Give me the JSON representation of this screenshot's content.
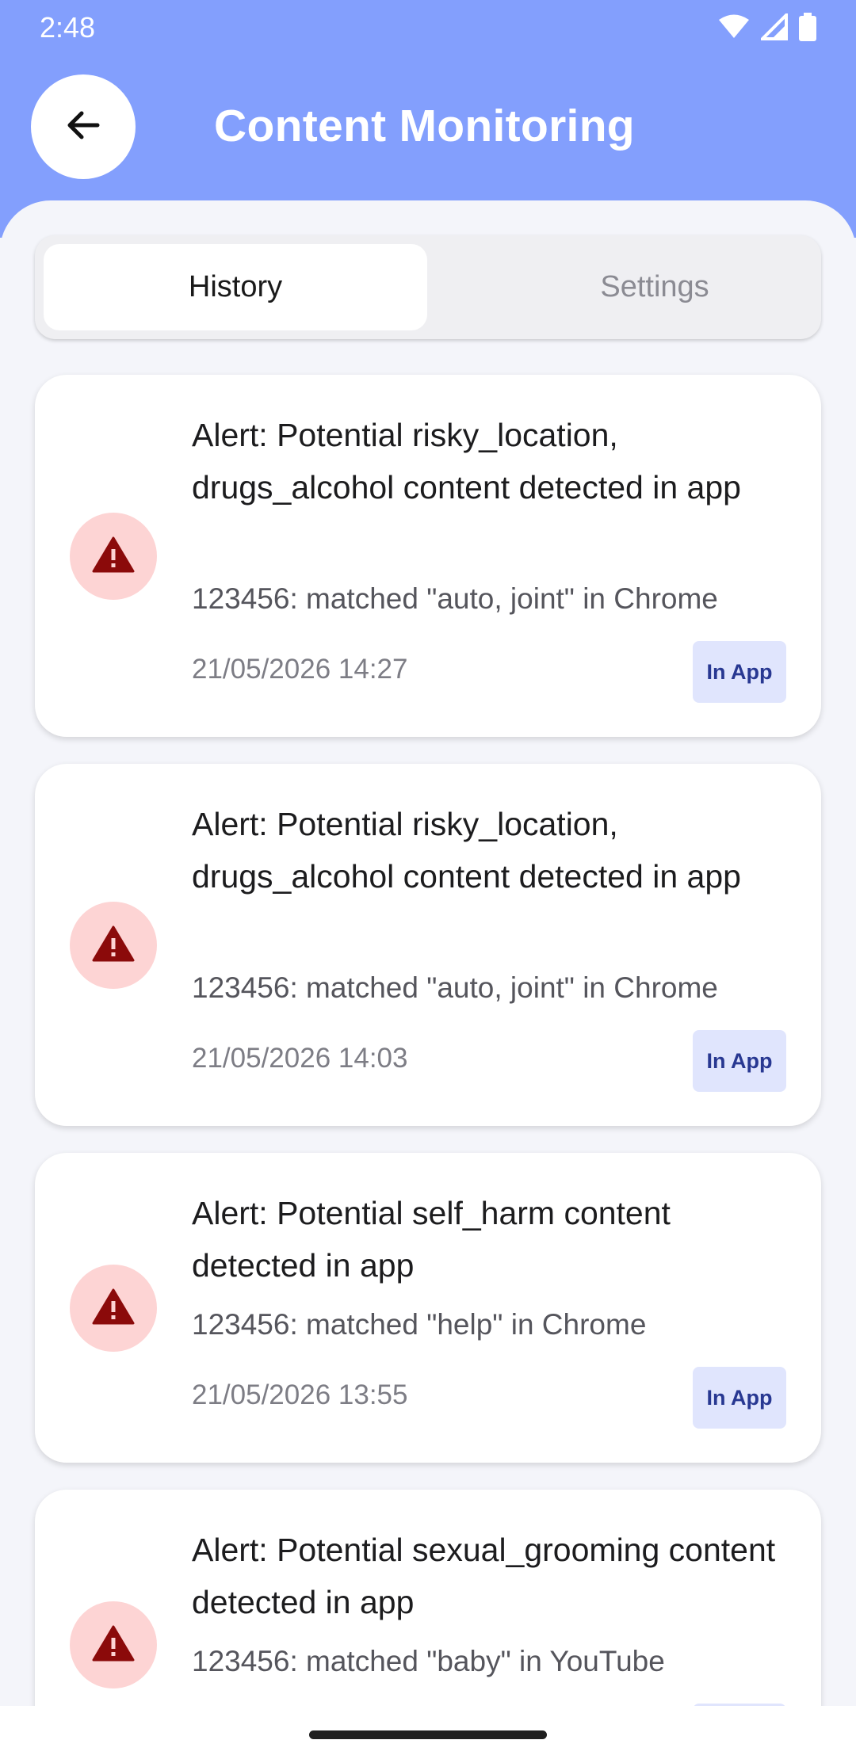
{
  "status_bar": {
    "time": "2:48",
    "icons": [
      "wifi-icon",
      "signal-icon",
      "battery-icon"
    ]
  },
  "header": {
    "back_icon": "arrow-left-icon",
    "title": "Content Monitoring"
  },
  "tabs": [
    {
      "label": "History",
      "active": true
    },
    {
      "label": "Settings",
      "active": false
    }
  ],
  "alerts": [
    {
      "icon": "warning-icon",
      "title": "Alert: Potential risky_location, drugs_alcohol content detected in app",
      "detail": "123456: matched \"auto, joint\" in Chrome",
      "timestamp": "21/05/2026 14:27",
      "badge": "In App"
    },
    {
      "icon": "warning-icon",
      "title": "Alert: Potential risky_location, drugs_alcohol content detected in app",
      "detail": "123456: matched \"auto, joint\" in Chrome",
      "timestamp": "21/05/2026 14:03",
      "badge": "In App"
    },
    {
      "icon": "warning-icon",
      "title": "Alert: Potential self_harm content detected in app",
      "detail": "123456: matched \"help\" in Chrome",
      "timestamp": "21/05/2026 13:55",
      "badge": "In App"
    },
    {
      "icon": "warning-icon",
      "title": "Alert: Potential sexual_grooming content detected in app",
      "detail": "123456: matched \"baby\" in YouTube",
      "timestamp": "",
      "badge": ""
    }
  ],
  "colors": {
    "header_bg": "#839ffd",
    "alert_icon": "#8b0a0a",
    "alert_circle": "#fdd4d4",
    "badge_bg": "#e0e5fd",
    "badge_text": "#283892"
  }
}
